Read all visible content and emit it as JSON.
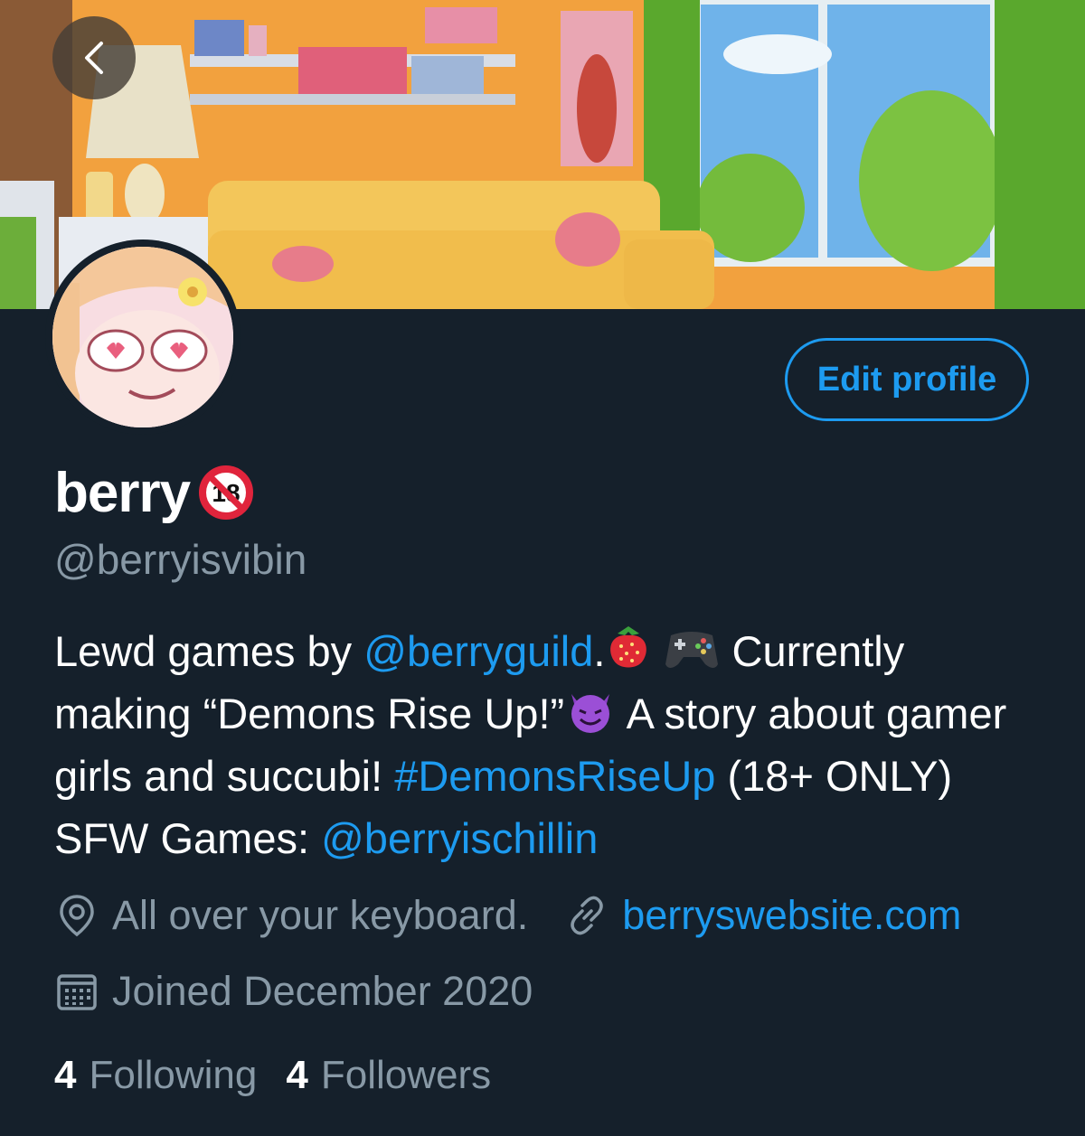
{
  "profile": {
    "display_name": "berry",
    "handle": "@berryisvibin",
    "edit_label": "Edit profile"
  },
  "bio": {
    "t1": "Lewd games by ",
    "mention1": "@berryguild",
    "t2": ".",
    "t3": " Currently making “Demons Rise Up!”",
    "t4": " A story about gamer girls and succubi! ",
    "hashtag": "#DemonsRiseUp",
    "t5": " (18+ ONLY) SFW Games: ",
    "mention2": "@berryischillin"
  },
  "meta": {
    "location": "All over your keyboard.",
    "website": "berryswebsite.com",
    "joined": "Joined December 2020"
  },
  "stats": {
    "following_count": "4",
    "following_label": "Following",
    "followers_count": "4",
    "followers_label": "Followers"
  },
  "icons": [
    "back-arrow-icon",
    "age-restricted-18-icon",
    "strawberry-emoji",
    "game-controller-emoji",
    "smiling-devil-emoji",
    "location-pin-icon",
    "link-icon",
    "calendar-icon"
  ],
  "colors": {
    "background": "#15202b",
    "accent": "#1d9bf0",
    "secondary_text": "#8899a6"
  }
}
